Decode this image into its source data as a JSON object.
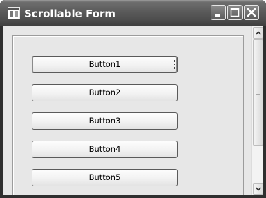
{
  "window": {
    "title": "Scrollable Form",
    "icon": "form-app-icon",
    "caption_buttons": [
      "minimize-icon",
      "maximize-icon",
      "close-icon"
    ]
  },
  "form": {
    "buttons": [
      {
        "label": "Button1",
        "focused": true
      },
      {
        "label": "Button2",
        "focused": false
      },
      {
        "label": "Button3",
        "focused": false
      },
      {
        "label": "Button4",
        "focused": false
      },
      {
        "label": "Button5",
        "focused": false
      }
    ]
  },
  "scrollbar": {
    "up_icon": "chevron-up-icon",
    "down_icon": "chevron-down-icon",
    "position": 0
  }
}
